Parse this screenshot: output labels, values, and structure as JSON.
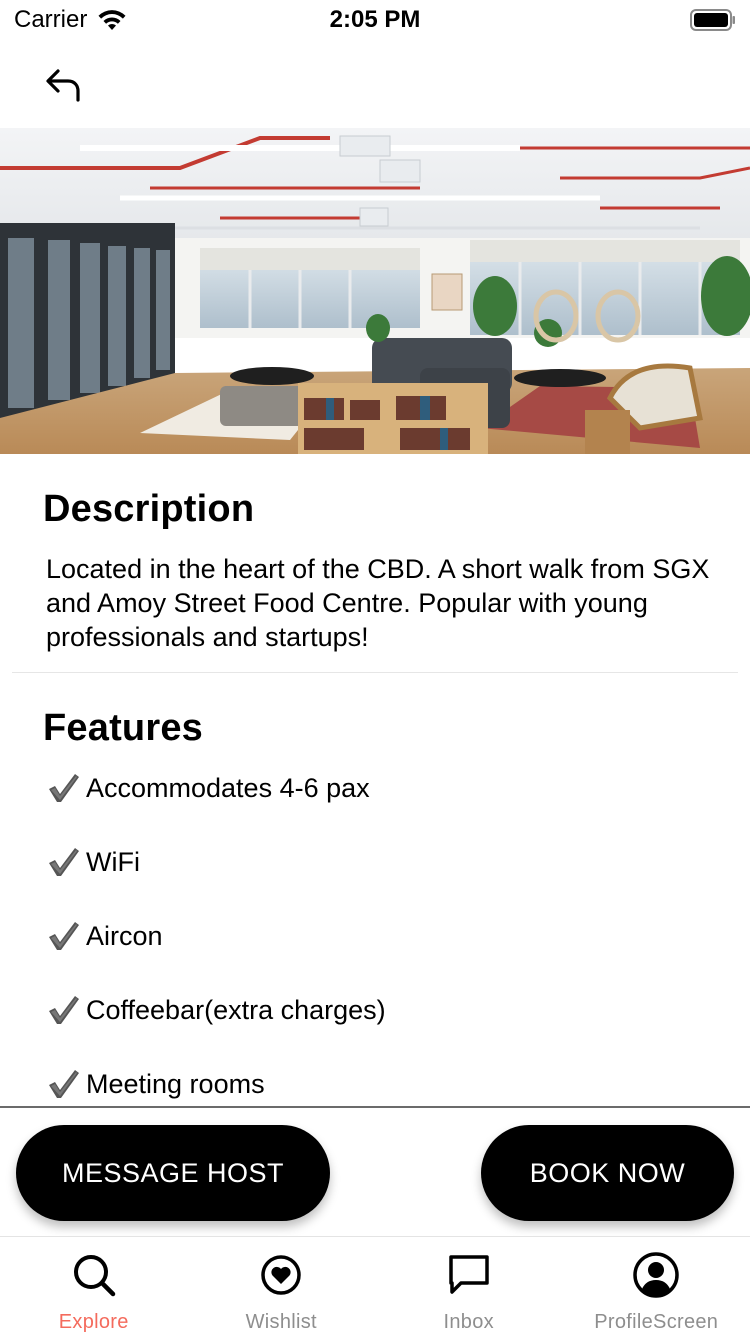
{
  "status_bar": {
    "carrier": "Carrier",
    "time": "2:05 PM"
  },
  "nav": {
    "back_icon": "back-arrow-icon"
  },
  "description": {
    "title": "Description",
    "text": "Located in the heart of the CBD. A short walk from SGX and Amoy Street Food Centre. Popular with young professionals and startups!"
  },
  "features": {
    "title": "Features",
    "items": [
      {
        "label": "Accommodates 4-6 pax"
      },
      {
        "label": "WiFi"
      },
      {
        "label": "Aircon"
      },
      {
        "label": "Coffeebar(extra charges)"
      },
      {
        "label": "Meeting rooms"
      }
    ]
  },
  "actions": {
    "message_label": "MESSAGE HOST",
    "book_label": "BOOK NOW"
  },
  "tabs": [
    {
      "label": "Explore",
      "icon": "search-icon",
      "active": true
    },
    {
      "label": "Wishlist",
      "icon": "heart-icon",
      "active": false
    },
    {
      "label": "Inbox",
      "icon": "chat-icon",
      "active": false
    },
    {
      "label": "ProfileScreen",
      "icon": "user-icon",
      "active": false
    }
  ],
  "colors": {
    "active_tab": "#f46b5d",
    "inactive_tab": "#8e8e8e",
    "button_bg": "#000000",
    "button_text": "#ffffff"
  }
}
